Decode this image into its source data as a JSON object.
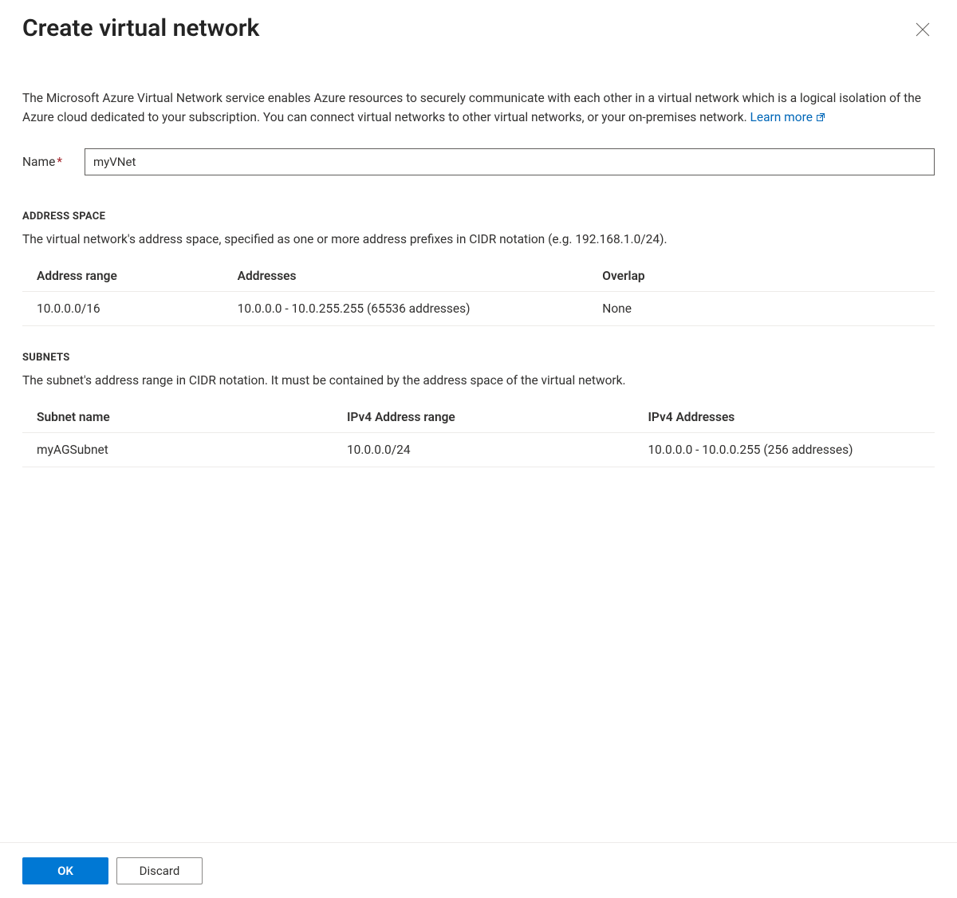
{
  "header": {
    "title": "Create virtual network"
  },
  "intro": {
    "text": "The Microsoft Azure Virtual Network service enables Azure resources to securely communicate with each other in a virtual network which is a logical isolation of the Azure cloud dedicated to your subscription. You can connect virtual networks to other virtual networks, or your on-premises network.  ",
    "link_text": "Learn more"
  },
  "name_field": {
    "label": "Name",
    "value": "myVNet"
  },
  "address_space": {
    "heading": "ADDRESS SPACE",
    "description": "The virtual network's address space, specified as one or more address prefixes in CIDR notation (e.g. 192.168.1.0/24).",
    "columns": {
      "range": "Address range",
      "addresses": "Addresses",
      "overlap": "Overlap"
    },
    "rows": [
      {
        "range": "10.0.0.0/16",
        "addresses": "10.0.0.0 - 10.0.255.255 (65536 addresses)",
        "overlap": "None"
      }
    ]
  },
  "subnets": {
    "heading": "SUBNETS",
    "description": "The subnet's address range in CIDR notation. It must be contained by the address space of the virtual network.",
    "columns": {
      "name": "Subnet name",
      "range": "IPv4 Address range",
      "addresses": "IPv4 Addresses"
    },
    "rows": [
      {
        "name": "myAGSubnet",
        "range": "10.0.0.0/24",
        "addresses": "10.0.0.0 - 10.0.0.255 (256 addresses)"
      }
    ]
  },
  "footer": {
    "ok_label": "OK",
    "discard_label": "Discard"
  }
}
